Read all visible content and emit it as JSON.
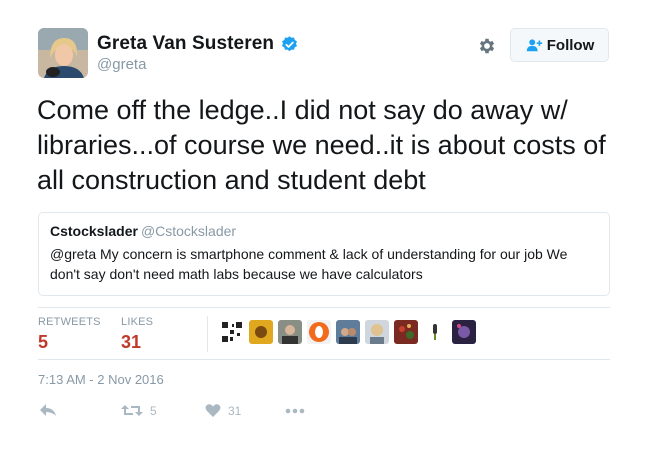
{
  "user": {
    "display_name": "Greta Van Susteren",
    "handle": "@greta",
    "verified_icon": "verified-badge-icon",
    "follow_label": "Follow",
    "follow_icon": "add-user-icon"
  },
  "tweet_text": "Come off the ledge..I did not say do away w/ libraries...of course we need..it is about costs of all construction and student debt",
  "quoted_tweet": {
    "name": "Cstockslader",
    "handle": "@Cstockslader",
    "text": "@greta My concern is smartphone comment & lack of understanding for our job We don't say don't need math labs because we have calculators"
  },
  "stats": {
    "retweets_label": "RETWEETS",
    "retweets_value": "5",
    "likes_label": "LIKES",
    "likes_value": "31"
  },
  "timestamp": "7:13 AM - 2 Nov 2016",
  "actions": {
    "reply_icon": "reply-icon",
    "retweet_icon": "retweet-icon",
    "retweet_count": "5",
    "like_icon": "heart-icon",
    "like_count": "31",
    "more_icon": "more-icon"
  },
  "colors": {
    "stat_value": "#c0392b",
    "muted": "#8899a6",
    "verified": "#1da1f2"
  }
}
